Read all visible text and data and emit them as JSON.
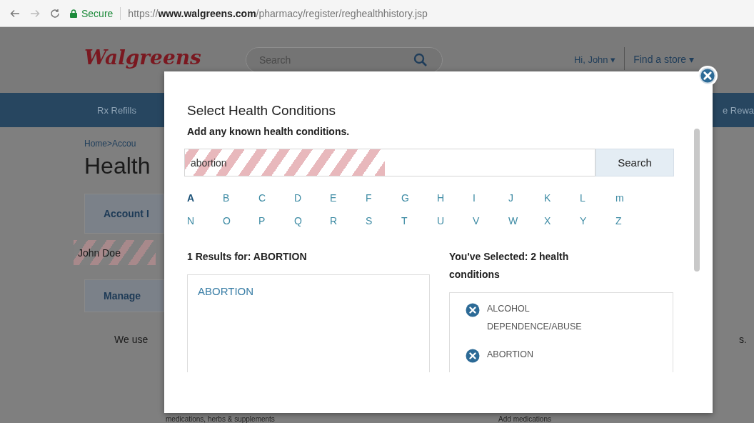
{
  "browser": {
    "secure_label": "Secure",
    "url": "https://**www.walgreens.com**/pharmacy/register/reghealthhistory.jsp"
  },
  "header": {
    "logo": "Walgreens",
    "search_placeholder": "Search",
    "greeting": "Hi, John",
    "find_store": "Find a store",
    "caret": "▾"
  },
  "nav": {
    "left": "Rx Refills",
    "right": "e Rewa"
  },
  "background": {
    "breadcrumb": "Home>Accou",
    "heading": "Health",
    "account_tab": "Account I",
    "name": {
      "text": "John Doe",
      "redacted": true
    },
    "manage_tab": "Manage",
    "intro": "We use",
    "intro_end": "s.",
    "footer_left": "medications, herbs & supplements",
    "footer_right": "Add medications"
  },
  "modal": {
    "title": "Select Health Conditions",
    "subtitle": "Add any known health conditions.",
    "search": {
      "value": "abortion",
      "redacted": true,
      "button": "Search"
    },
    "letters": [
      {
        "label": "A",
        "selected": true
      },
      {
        "label": "B",
        "selected": false
      },
      {
        "label": "C",
        "selected": false
      },
      {
        "label": "D",
        "selected": false
      },
      {
        "label": "E",
        "selected": false
      },
      {
        "label": "F",
        "selected": false
      },
      {
        "label": "G",
        "selected": false
      },
      {
        "label": "H",
        "selected": false
      },
      {
        "label": "I",
        "selected": false
      },
      {
        "label": "J",
        "selected": false
      },
      {
        "label": "K",
        "selected": false
      },
      {
        "label": "L",
        "selected": false
      },
      {
        "label": "m",
        "selected": false
      },
      {
        "label": "N",
        "selected": false
      },
      {
        "label": "O",
        "selected": false
      },
      {
        "label": "P",
        "selected": false
      },
      {
        "label": "Q",
        "selected": false
      },
      {
        "label": "R",
        "selected": false
      },
      {
        "label": "S",
        "selected": false
      },
      {
        "label": "T",
        "selected": false
      },
      {
        "label": "U",
        "selected": false
      },
      {
        "label": "V",
        "selected": false
      },
      {
        "label": "W",
        "selected": false
      },
      {
        "label": "X",
        "selected": false
      },
      {
        "label": "Y",
        "selected": false
      },
      {
        "label": "Z",
        "selected": false
      }
    ],
    "results_heading": "1 Results for: ABORTION",
    "results": [
      "ABORTION"
    ],
    "selected_heading": "You've Selected: 2 health conditions",
    "selected": [
      "ALCOHOL DEPENDENCE/ABUSE",
      "ABORTION"
    ]
  }
}
